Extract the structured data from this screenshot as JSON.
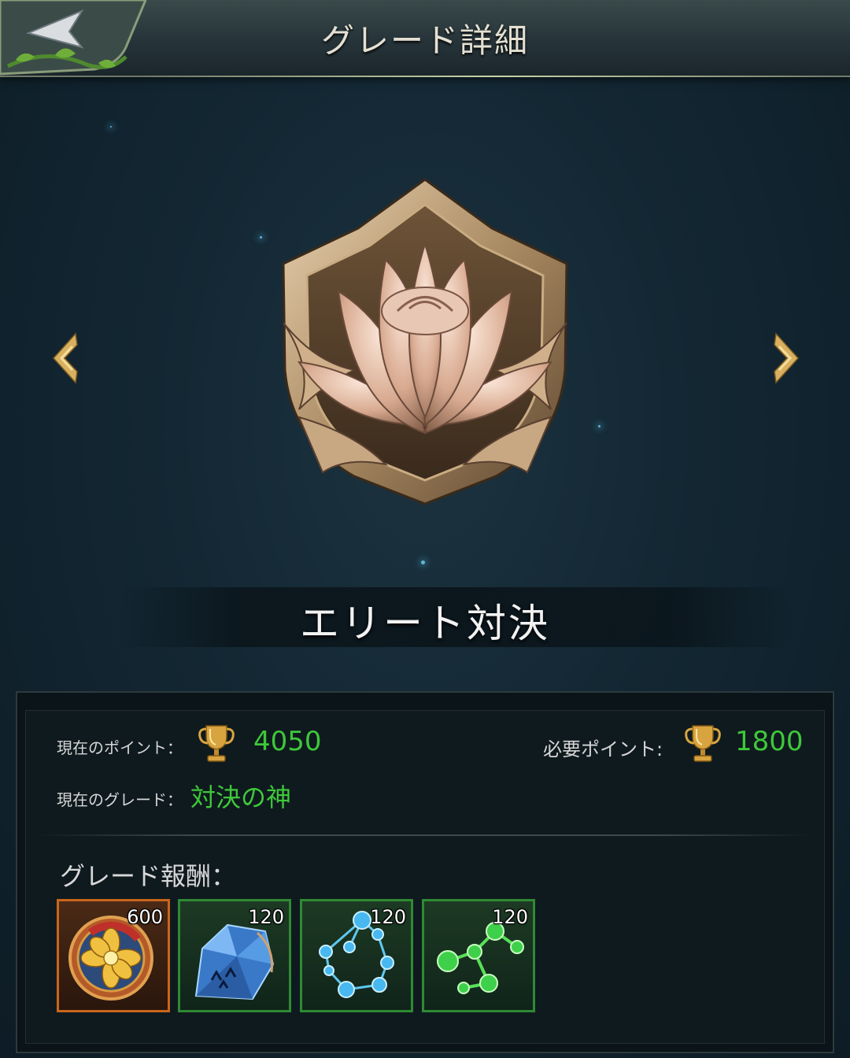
{
  "header": {
    "title": "グレード詳細",
    "back_icon": "back-arrow-icon"
  },
  "grade": {
    "name": "エリート対決",
    "emblem": "lotus-shield-emblem",
    "prev_icon": "chevron-left-icon",
    "next_icon": "chevron-right-icon"
  },
  "info": {
    "current_points_label": "現在のポイント：",
    "current_points": "4050",
    "required_points_label": "必要ポイント:",
    "required_points": "1800",
    "current_grade_label": "現在のグレード：",
    "current_grade": "対決の神",
    "trophy_icon": "trophy-icon"
  },
  "rewards": {
    "label": "グレード報酬：",
    "items": [
      {
        "icon": "gold-flower-medal-icon",
        "count": "600",
        "frame": "orange"
      },
      {
        "icon": "blue-crystal-icon",
        "count": "120",
        "frame": "green"
      },
      {
        "icon": "blue-molecule-icon",
        "count": "120",
        "frame": "green"
      },
      {
        "icon": "green-molecule-icon",
        "count": "120",
        "frame": "green"
      }
    ]
  },
  "colors": {
    "accent_green": "#3ec83a",
    "gold": "#d6a640",
    "frame_green": "#2f8a34",
    "frame_orange": "#c9661c"
  }
}
